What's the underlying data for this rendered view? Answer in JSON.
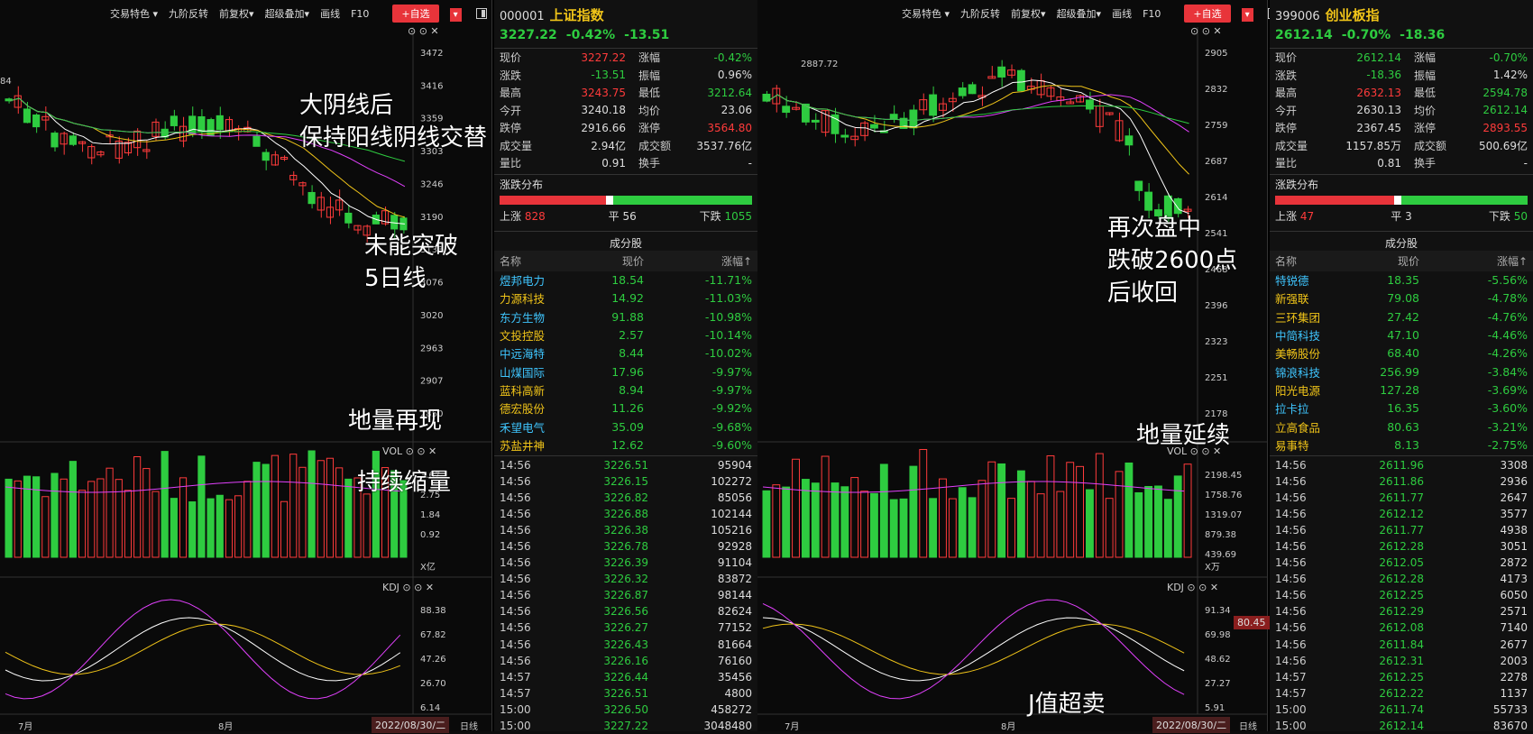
{
  "toolbar": {
    "items": [
      "交易特色 ▾",
      "九阶反转",
      "前复权▾",
      "超级叠加▾",
      "画线",
      "F10"
    ],
    "add_label": "+自选",
    "drop_label": "▾"
  },
  "left": {
    "code": "000001",
    "name": "上证指数",
    "price": "3227.22",
    "pct": "-0.42%",
    "chg": "-13.51",
    "quote": [
      [
        "现价",
        "3227.22",
        "red",
        "涨幅",
        "-0.42%",
        "green"
      ],
      [
        "涨跌",
        "-13.51",
        "green",
        "振幅",
        "0.96%",
        "white"
      ],
      [
        "最高",
        "3243.75",
        "red",
        "最低",
        "3212.64",
        "green"
      ],
      [
        "今开",
        "3240.18",
        "white",
        "均价",
        "23.06",
        "white"
      ],
      [
        "跌停",
        "2916.66",
        "white",
        "涨停",
        "3564.80",
        "red"
      ],
      [
        "成交量",
        "2.94亿",
        "white",
        "成交额",
        "3537.76亿",
        "white"
      ],
      [
        "量比",
        "0.91",
        "white",
        "换手",
        "-",
        "white"
      ]
    ],
    "dist_title": "涨跌分布",
    "up_label": "上涨",
    "up": "828",
    "flat_label": "平",
    "flat": "56",
    "down_label": "下跌",
    "down": "1055",
    "comp_title": "成分股",
    "comp_headers": [
      "名称",
      "现价",
      "涨幅↑"
    ],
    "components": [
      [
        "煜邦电力",
        "18.54",
        "-11.71%",
        "cyan"
      ],
      [
        "力源科技",
        "14.92",
        "-11.03%",
        "yellow"
      ],
      [
        "东方生物",
        "91.88",
        "-10.98%",
        "cyan"
      ],
      [
        "文投控股",
        "2.57",
        "-10.14%",
        "yellow"
      ],
      [
        "中远海特",
        "8.44",
        "-10.02%",
        "cyan"
      ],
      [
        "山煤国际",
        "17.96",
        "-9.97%",
        "cyan"
      ],
      [
        "蓝科高新",
        "8.94",
        "-9.97%",
        "yellow"
      ],
      [
        "德宏股份",
        "11.26",
        "-9.92%",
        "yellow"
      ],
      [
        "禾望电气",
        "35.09",
        "-9.68%",
        "cyan"
      ],
      [
        "苏盐井神",
        "12.62",
        "-9.60%",
        "yellow"
      ]
    ],
    "ticks": [
      [
        "14:56",
        "3226.51",
        "95904"
      ],
      [
        "14:56",
        "3226.15",
        "102272"
      ],
      [
        "14:56",
        "3226.82",
        "85056"
      ],
      [
        "14:56",
        "3226.88",
        "102144"
      ],
      [
        "14:56",
        "3226.38",
        "105216"
      ],
      [
        "14:56",
        "3226.78",
        "92928"
      ],
      [
        "14:56",
        "3226.39",
        "91104"
      ],
      [
        "14:56",
        "3226.32",
        "83872"
      ],
      [
        "14:56",
        "3226.87",
        "98144"
      ],
      [
        "14:56",
        "3226.56",
        "82624"
      ],
      [
        "14:56",
        "3226.27",
        "77152"
      ],
      [
        "14:56",
        "3226.43",
        "81664"
      ],
      [
        "14:56",
        "3226.16",
        "76160"
      ],
      [
        "14:57",
        "3226.44",
        "35456"
      ],
      [
        "14:57",
        "3226.51",
        "4800"
      ],
      [
        "15:00",
        "3226.50",
        "458272"
      ],
      [
        "15:00",
        "3227.22",
        "3048480"
      ]
    ],
    "yaxis": [
      "3472",
      "3416",
      "3359",
      "3303",
      "3246",
      "3190",
      "3133",
      "3076",
      "3020",
      "2963",
      "2907",
      "2850"
    ],
    "vol_axis": [
      "3.67",
      "2.75",
      "1.84",
      "0.92"
    ],
    "vol_unit": "X亿",
    "kdj_axis": [
      "88.38",
      "67.82",
      "47.26",
      "26.70",
      "6.14"
    ],
    "hi_label": "84",
    "annotations": [
      "大阴线后",
      "保持阳线阴线交替",
      "未能突破",
      "5日线",
      "地量再现",
      "持续缩量"
    ],
    "months": [
      "7月",
      "8月"
    ],
    "date": "2022/08/30/二",
    "period": "日线"
  },
  "right": {
    "code": "399006",
    "name": "创业板指",
    "price": "2612.14",
    "pct": "-0.70%",
    "chg": "-18.36",
    "quote": [
      [
        "现价",
        "2612.14",
        "green",
        "涨幅",
        "-0.70%",
        "green"
      ],
      [
        "涨跌",
        "-18.36",
        "green",
        "振幅",
        "1.42%",
        "white"
      ],
      [
        "最高",
        "2632.13",
        "red",
        "最低",
        "2594.78",
        "green"
      ],
      [
        "今开",
        "2630.13",
        "white",
        "均价",
        "2612.14",
        "green"
      ],
      [
        "跌停",
        "2367.45",
        "white",
        "涨停",
        "2893.55",
        "red"
      ],
      [
        "成交量",
        "1157.85万",
        "white",
        "成交额",
        "500.69亿",
        "white"
      ],
      [
        "量比",
        "0.81",
        "white",
        "换手",
        "-",
        "white"
      ]
    ],
    "dist_title": "涨跌分布",
    "up_label": "上涨",
    "up": "47",
    "flat_label": "平",
    "flat": "3",
    "down_label": "下跌",
    "down": "50",
    "comp_title": "成分股",
    "comp_headers": [
      "名称",
      "现价",
      "涨幅↑"
    ],
    "components": [
      [
        "特锐德",
        "18.35",
        "-5.56%",
        "cyan"
      ],
      [
        "新强联",
        "79.08",
        "-4.78%",
        "yellow"
      ],
      [
        "三环集团",
        "27.42",
        "-4.76%",
        "yellow"
      ],
      [
        "中简科技",
        "47.10",
        "-4.46%",
        "cyan"
      ],
      [
        "美畅股份",
        "68.40",
        "-4.26%",
        "yellow"
      ],
      [
        "锦浪科技",
        "256.99",
        "-3.84%",
        "cyan"
      ],
      [
        "阳光电源",
        "127.28",
        "-3.69%",
        "yellow"
      ],
      [
        "拉卡拉",
        "16.35",
        "-3.60%",
        "cyan"
      ],
      [
        "立高食品",
        "80.63",
        "-3.21%",
        "yellow"
      ],
      [
        "易事特",
        "8.13",
        "-2.75%",
        "yellow"
      ]
    ],
    "ticks": [
      [
        "14:56",
        "2611.96",
        "3308"
      ],
      [
        "14:56",
        "2611.86",
        "2936"
      ],
      [
        "14:56",
        "2611.77",
        "2647"
      ],
      [
        "14:56",
        "2612.12",
        "3577"
      ],
      [
        "14:56",
        "2611.77",
        "4938"
      ],
      [
        "14:56",
        "2612.28",
        "3051"
      ],
      [
        "14:56",
        "2612.05",
        "2872"
      ],
      [
        "14:56",
        "2612.28",
        "4173"
      ],
      [
        "14:56",
        "2612.25",
        "6050"
      ],
      [
        "14:56",
        "2612.29",
        "2571"
      ],
      [
        "14:56",
        "2612.08",
        "7140"
      ],
      [
        "14:56",
        "2611.84",
        "2677"
      ],
      [
        "14:56",
        "2612.31",
        "2003"
      ],
      [
        "14:57",
        "2612.25",
        "2278"
      ],
      [
        "14:57",
        "2612.22",
        "1137"
      ],
      [
        "15:00",
        "2611.74",
        "55733"
      ],
      [
        "15:00",
        "2612.14",
        "83670"
      ]
    ],
    "yaxis": [
      "2905",
      "2832",
      "2759",
      "2687",
      "2614",
      "2541",
      "2468",
      "2396",
      "2323",
      "2251",
      "2178"
    ],
    "vol_axis": [
      "2198.45",
      "1758.76",
      "1319.07",
      "879.38",
      "439.69"
    ],
    "vol_unit": "X万",
    "kdj_axis": [
      "91.34",
      "69.98",
      "48.62",
      "27.27",
      "5.91"
    ],
    "kdj_cur": "80.45",
    "hi_label": "2887.72",
    "annotations": [
      "再次盘中",
      "跌破2600点",
      "后收回",
      "地量延续",
      "J值超卖"
    ],
    "months": [
      "7月",
      "8月"
    ],
    "date": "2022/08/30/二",
    "period": "日线"
  },
  "panel_labels": {
    "vol": "VOL",
    "kdj": "KDJ"
  },
  "colors": {
    "up": "#ff3b3b",
    "down": "#2ecc40",
    "ma5": "#ffffff",
    "ma10": "#f0c419",
    "ma20": "#e040fb",
    "ma60": "#2ecc40"
  }
}
